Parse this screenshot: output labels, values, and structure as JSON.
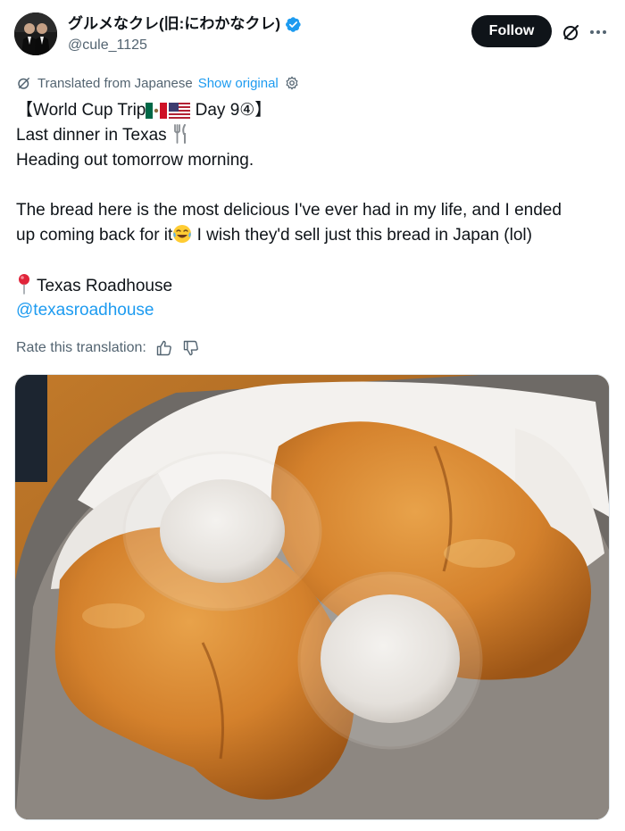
{
  "author": {
    "display_name": "グルメなクレ(旧:にわかなクレ)",
    "handle": "@cule_1125",
    "verified": true
  },
  "actions": {
    "follow_label": "Follow"
  },
  "translation": {
    "notice": "Translated from Japanese",
    "show_original_label": "Show original"
  },
  "tweet": {
    "line1_pre": "【World Cup Trip",
    "line1_post": " Day 9④】",
    "line2": "Last dinner in Texas",
    "line3": "Heading out tomorrow morning.",
    "line4": "The bread here is the most delicious I've ever had in my life, and I ended",
    "line5_pre": "up coming back for it",
    "line5_post": " I wish they'd sell just this bread in Japan (lol)",
    "location": "Texas Roadhouse",
    "mention": "@texasroadhouse"
  },
  "rating": {
    "label": "Rate this translation:"
  },
  "icons": {
    "grok": "grok-icon",
    "more": "more-icon",
    "verified": "verified-badge-icon",
    "translate": "translate-icon",
    "settings": "gear-icon",
    "thumb_up": "thumb-up-icon",
    "thumb_down": "thumb-down-icon",
    "pin": "round-pushpin-icon",
    "flags": "mexico-flag-icon, usa-flag-icon",
    "cutlery": "fork-and-knife-icon",
    "emoji": "tears-of-joy-icon"
  },
  "colors": {
    "text": "#0f1419",
    "secondary": "#536471",
    "link": "#1d9bf0",
    "button_bg": "#0f1419",
    "button_text": "#ffffff"
  }
}
